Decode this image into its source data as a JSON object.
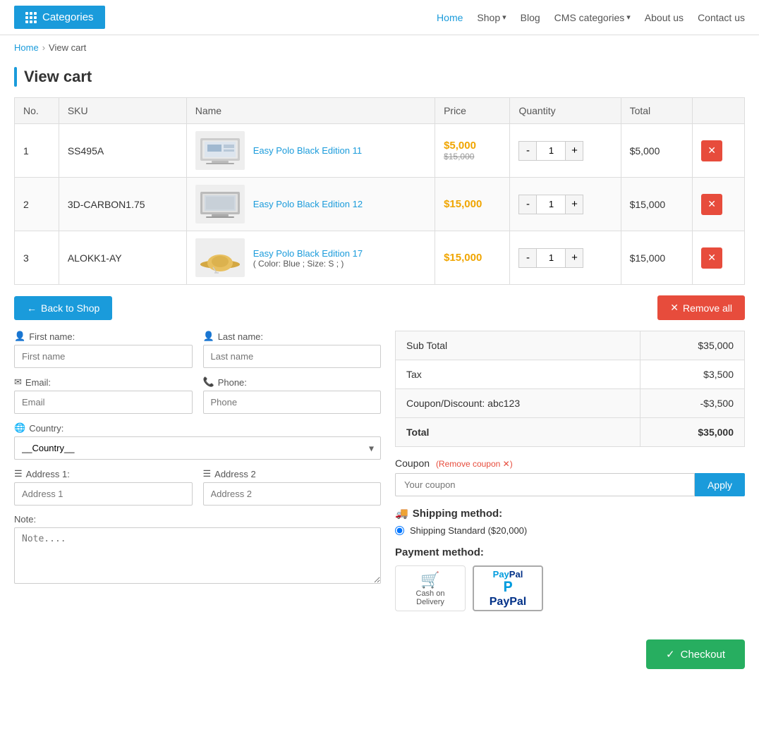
{
  "header": {
    "categories_label": "Categories",
    "nav": [
      {
        "label": "Home",
        "active": true
      },
      {
        "label": "Shop",
        "dropdown": true
      },
      {
        "label": "Blog"
      },
      {
        "label": "CMS categories",
        "dropdown": true
      },
      {
        "label": "About us"
      },
      {
        "label": "Contact us"
      }
    ]
  },
  "breadcrumb": {
    "home": "Home",
    "current": "View cart"
  },
  "page_title": "View cart",
  "table": {
    "columns": [
      "No.",
      "SKU",
      "Name",
      "Price",
      "Quantity",
      "Total",
      ""
    ],
    "rows": [
      {
        "no": "1",
        "sku": "SS495A",
        "name": "Easy Polo Black Edition 11",
        "price_current": "$5,000",
        "price_old": "$15,000",
        "qty": "1",
        "total": "$5,000",
        "has_old_price": true
      },
      {
        "no": "2",
        "sku": "3D-CARBON1.75",
        "name": "Easy Polo Black Edition 12",
        "price_current": "$15,000",
        "price_old": null,
        "qty": "1",
        "total": "$15,000",
        "has_old_price": false
      },
      {
        "no": "3",
        "sku": "ALOKK1-AY",
        "name": "Easy Polo Black Edition 17",
        "name_extra": "( Color: Blue ; Size: S ; )",
        "price_current": "$15,000",
        "price_old": null,
        "qty": "1",
        "total": "$15,000",
        "has_old_price": false
      }
    ]
  },
  "actions": {
    "back_label": "Back to Shop",
    "remove_all_label": "Remove all"
  },
  "form": {
    "first_name_label": "First name:",
    "last_name_label": "Last name:",
    "first_name_placeholder": "First name",
    "last_name_placeholder": "Last name",
    "email_label": "Email:",
    "email_placeholder": "Email",
    "phone_label": "Phone:",
    "phone_placeholder": "Phone",
    "country_label": "Country:",
    "country_placeholder": "__Country__",
    "address1_label": "Address 1:",
    "address1_placeholder": "Address 1",
    "address2_label": "Address 2",
    "address2_placeholder": "Address 2",
    "note_label": "Note:",
    "note_placeholder": "Note...."
  },
  "summary": {
    "subtotal_label": "Sub Total",
    "subtotal_value": "$35,000",
    "tax_label": "Tax",
    "tax_value": "$3,500",
    "coupon_label": "Coupon/Discount: abc123",
    "coupon_value": "-$3,500",
    "total_label": "Total",
    "total_value": "$35,000"
  },
  "coupon": {
    "label": "Coupon",
    "remove_label": "(Remove coupon ✕)",
    "placeholder": "Your coupon",
    "apply_label": "Apply"
  },
  "shipping": {
    "title": "Shipping method:",
    "option": "Shipping Standard ($20,000)"
  },
  "payment": {
    "title": "Payment method:",
    "options": [
      "Cash on Delivery",
      "PayPal"
    ]
  },
  "checkout": {
    "label": "Checkout"
  }
}
